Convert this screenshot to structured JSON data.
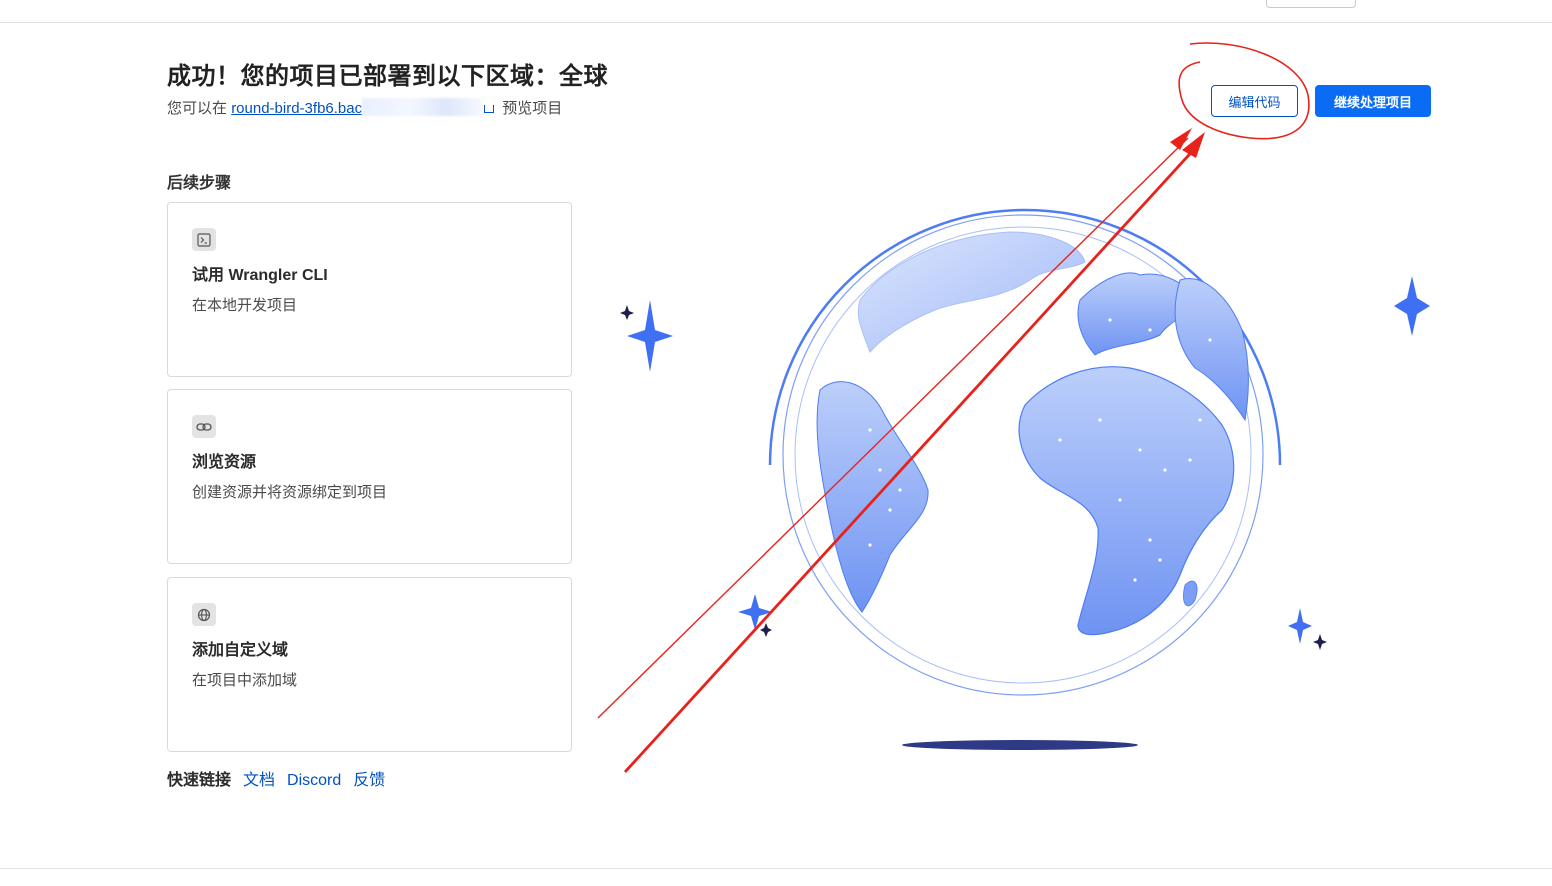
{
  "page": {
    "title": "成功！您的项目已部署到以下区域：全球",
    "subtitle_prefix": "您可以在",
    "preview_link": "round-bird-3fb6.bac",
    "subtitle_suffix": "预览项目"
  },
  "actions": {
    "edit_code": "编辑代码",
    "continue": "继续处理项目"
  },
  "next_steps": {
    "label": "后续步骤",
    "cards": [
      {
        "title": "试用 Wrangler CLI",
        "desc": "在本地开发项目",
        "icon": "terminal-icon"
      },
      {
        "title": "浏览资源",
        "desc": "创建资源并将资源绑定到项目",
        "icon": "link-icon"
      },
      {
        "title": "添加自定义域",
        "desc": "在项目中添加域",
        "icon": "globe-icon"
      }
    ]
  },
  "quick_links": {
    "label": "快速链接",
    "links": [
      "文档",
      "Discord",
      "反馈"
    ]
  },
  "colors": {
    "accent": "#0051c3",
    "primary_button": "#0a6cf5",
    "annotation_red": "#e8221b",
    "globe_blue": "#4d7cf4"
  }
}
